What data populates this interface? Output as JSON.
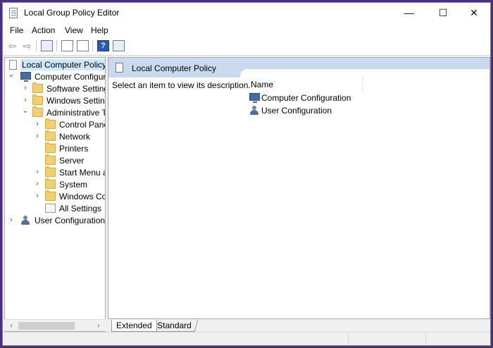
{
  "window": {
    "title": "Local Group Policy Editor",
    "minimize_glyph": "—",
    "maximize_glyph": "☐",
    "close_glyph": "✕"
  },
  "menu": {
    "items": [
      {
        "label": "File"
      },
      {
        "label": "Action"
      },
      {
        "label": "View"
      },
      {
        "label": "Help"
      }
    ]
  },
  "toolbar": {
    "back_glyph": "⇦",
    "forward_glyph": "⇨",
    "help_glyph": "?",
    "icons": [
      "back-arrow-icon",
      "forward-arrow-icon",
      "show-hide-console-tree-icon",
      "properties-icon",
      "export-list-icon",
      "help-icon",
      "show-hide-action-pane-icon"
    ]
  },
  "tree": {
    "arrow_collapsed": "›",
    "arrow_expanded": "⌄",
    "nodes": [
      {
        "label": "Local Computer Policy",
        "icon": "policy-icon",
        "expanded": null,
        "selected": true
      },
      {
        "label": "Computer Configura",
        "icon": "computer-icon",
        "expanded": true
      },
      {
        "label": "Software Settings",
        "icon": "folder-icon",
        "expanded": false
      },
      {
        "label": "Windows Setting",
        "icon": "folder-icon",
        "expanded": false
      },
      {
        "label": "Administrative Te",
        "icon": "folder-icon",
        "expanded": true
      },
      {
        "label": "Control Panel",
        "icon": "folder-icon",
        "expanded": false
      },
      {
        "label": "Network",
        "icon": "folder-icon",
        "expanded": false
      },
      {
        "label": "Printers",
        "icon": "folder-icon",
        "expanded": null
      },
      {
        "label": "Server",
        "icon": "folder-icon",
        "expanded": null
      },
      {
        "label": "Start Menu ar",
        "icon": "folder-icon",
        "expanded": false
      },
      {
        "label": "System",
        "icon": "folder-icon",
        "expanded": false
      },
      {
        "label": "Windows Cor",
        "icon": "folder-icon",
        "expanded": false
      },
      {
        "label": "All Settings",
        "icon": "all-settings-icon",
        "expanded": null
      },
      {
        "label": "User Configuration",
        "icon": "user-icon",
        "expanded": false
      }
    ]
  },
  "scrollbar": {
    "left_glyph": "‹",
    "right_glyph": "›"
  },
  "details": {
    "header_title": "Local Computer Policy",
    "description": "Select an item to view its description.",
    "column_name": "Name",
    "items": [
      {
        "label": "Computer Configuration",
        "icon": "computer-icon"
      },
      {
        "label": "User Configuration",
        "icon": "user-icon"
      }
    ]
  },
  "tabs": [
    {
      "label": "Extended",
      "active": true
    },
    {
      "label": "Standard",
      "active": false
    }
  ]
}
